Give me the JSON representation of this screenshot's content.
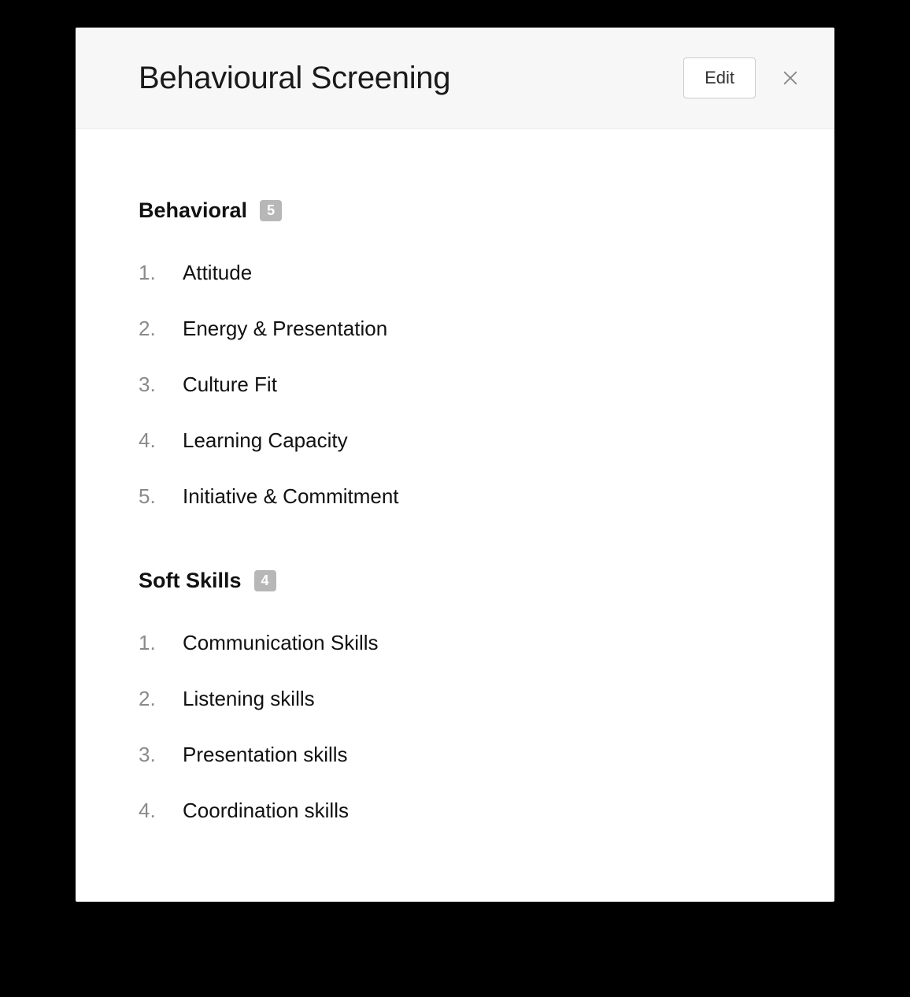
{
  "header": {
    "title": "Behavioural Screening",
    "edit_label": "Edit"
  },
  "sections": [
    {
      "title": "Behavioral",
      "count": "5",
      "items": [
        "Attitude",
        "Energy & Presentation",
        "Culture Fit",
        "Learning Capacity",
        "Initiative & Commitment"
      ]
    },
    {
      "title": "Soft Skills",
      "count": "4",
      "items": [
        "Communication Skills",
        "Listening skills",
        "Presentation skills",
        "Coordination skills"
      ]
    }
  ]
}
